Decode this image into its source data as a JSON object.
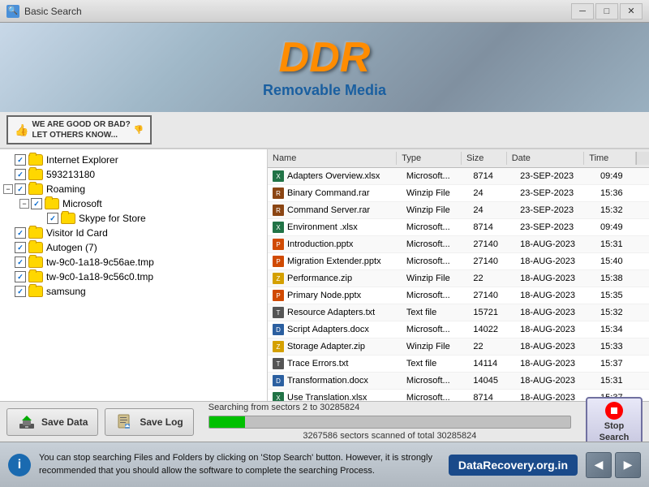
{
  "titleBar": {
    "icon": "🔍",
    "title": "Basic Search",
    "minimizeLabel": "─",
    "maximizeLabel": "□",
    "closeLabel": "✕"
  },
  "header": {
    "logo": "DDR",
    "subtitle": "Removable Media"
  },
  "banner": {
    "text1": "WE ARE GOOD OR BAD?",
    "text2": "LET OTHERS KNOW..."
  },
  "tree": {
    "items": [
      {
        "id": 1,
        "label": "Internet Explorer",
        "indent": 0,
        "checked": true,
        "hasExpand": false,
        "expandState": null
      },
      {
        "id": 2,
        "label": "593213180",
        "indent": 0,
        "checked": true,
        "hasExpand": false,
        "expandState": null
      },
      {
        "id": 3,
        "label": "Roaming",
        "indent": 0,
        "checked": true,
        "hasExpand": true,
        "expandState": "minus"
      },
      {
        "id": 4,
        "label": "Microsoft",
        "indent": 1,
        "checked": true,
        "hasExpand": true,
        "expandState": "minus"
      },
      {
        "id": 5,
        "label": "Skype for Store",
        "indent": 2,
        "checked": true,
        "hasExpand": false,
        "expandState": null
      },
      {
        "id": 6,
        "label": "Visitor Id Card",
        "indent": 0,
        "checked": true,
        "hasExpand": false,
        "expandState": null
      },
      {
        "id": 7,
        "label": "Autogen (7)",
        "indent": 0,
        "checked": true,
        "hasExpand": false,
        "expandState": null
      },
      {
        "id": 8,
        "label": "tw-9c0-1a18-9c56ae.tmp",
        "indent": 0,
        "checked": true,
        "hasExpand": false,
        "expandState": null
      },
      {
        "id": 9,
        "label": "tw-9c0-1a18-9c56c0.tmp",
        "indent": 0,
        "checked": true,
        "hasExpand": false,
        "expandState": null
      },
      {
        "id": 10,
        "label": "samsung",
        "indent": 0,
        "checked": true,
        "hasExpand": false,
        "expandState": null
      }
    ]
  },
  "fileList": {
    "columns": [
      "Name",
      "Type",
      "Size",
      "Date",
      "Time"
    ],
    "files": [
      {
        "name": "Adapters Overview.xlsx",
        "type": "Microsoft...",
        "size": "8714",
        "date": "23-SEP-2023",
        "time": "09:49",
        "iconType": "xlsx"
      },
      {
        "name": "Binary Command.rar",
        "type": "Winzip File",
        "size": "24",
        "date": "23-SEP-2023",
        "time": "15:36",
        "iconType": "rar"
      },
      {
        "name": "Command Server.rar",
        "type": "Winzip File",
        "size": "24",
        "date": "23-SEP-2023",
        "time": "15:32",
        "iconType": "rar"
      },
      {
        "name": "Environment .xlsx",
        "type": "Microsoft...",
        "size": "8714",
        "date": "23-SEP-2023",
        "time": "09:49",
        "iconType": "xlsx"
      },
      {
        "name": "Introduction.pptx",
        "type": "Microsoft...",
        "size": "27140",
        "date": "18-AUG-2023",
        "time": "15:31",
        "iconType": "pptx"
      },
      {
        "name": "Migration Extender.pptx",
        "type": "Microsoft...",
        "size": "27140",
        "date": "18-AUG-2023",
        "time": "15:40",
        "iconType": "pptx"
      },
      {
        "name": "Performance.zip",
        "type": "Winzip File",
        "size": "22",
        "date": "18-AUG-2023",
        "time": "15:38",
        "iconType": "zip"
      },
      {
        "name": "Primary Node.pptx",
        "type": "Microsoft...",
        "size": "27140",
        "date": "18-AUG-2023",
        "time": "15:35",
        "iconType": "pptx"
      },
      {
        "name": "Resource Adapters.txt",
        "type": "Text file",
        "size": "15721",
        "date": "18-AUG-2023",
        "time": "15:32",
        "iconType": "txt"
      },
      {
        "name": "Script Adapters.docx",
        "type": "Microsoft...",
        "size": "14022",
        "date": "18-AUG-2023",
        "time": "15:34",
        "iconType": "docx"
      },
      {
        "name": "Storage Adapter.zip",
        "type": "Winzip File",
        "size": "22",
        "date": "18-AUG-2023",
        "time": "15:33",
        "iconType": "zip"
      },
      {
        "name": "Trace Errors.txt",
        "type": "Text file",
        "size": "14114",
        "date": "18-AUG-2023",
        "time": "15:37",
        "iconType": "txt"
      },
      {
        "name": "Transformation.docx",
        "type": "Microsoft...",
        "size": "14045",
        "date": "18-AUG-2023",
        "time": "15:31",
        "iconType": "docx"
      },
      {
        "name": "Use Translation.xlsx",
        "type": "Microsoft...",
        "size": "8714",
        "date": "18-AUG-2023",
        "time": "15:37",
        "iconType": "xlsx"
      }
    ]
  },
  "actions": {
    "saveDataLabel": "Save Data",
    "saveLogLabel": "Save Log"
  },
  "progress": {
    "searchingText": "Searching from sectors   2 to 30285824",
    "sectorsText": "3267586  sectors scanned of total 30285824",
    "percent": 10,
    "stopLabel1": "Stop",
    "stopLabel2": "Search"
  },
  "statusBar": {
    "message": "You can stop searching Files and Folders by clicking on 'Stop Search' button. However, it is strongly recommended that you should allow the software to complete the searching Process.",
    "brand": "DataRecovery.org.in"
  }
}
